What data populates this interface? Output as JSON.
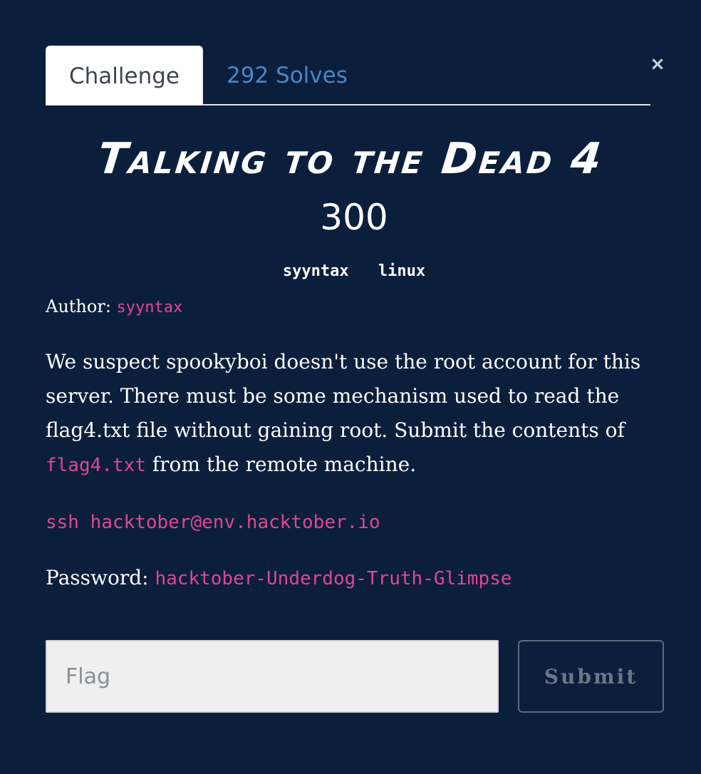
{
  "tabs": {
    "challenge": "Challenge",
    "solves": "292 Solves"
  },
  "close_icon": "×",
  "challenge": {
    "title": "Talking to the Dead 4",
    "points": "300",
    "tags": [
      "syyntax",
      "linux"
    ],
    "author_label": "Author:",
    "author_name": "syyntax",
    "description_part1": "We suspect spookyboi doesn't use the root account for this server. There must be some mechanism used to read the flag4.txt file without gaining root. Submit the contents of ",
    "description_code": "flag4.txt",
    "description_part2": " from the remote machine.",
    "ssh_command": "ssh hacktober@env.hacktober.io",
    "password_label": "Password:",
    "password_value": "hacktober-Underdog-Truth-Glimpse"
  },
  "form": {
    "flag_placeholder": "Flag",
    "flag_value": "",
    "submit_label": "Submit"
  },
  "colors": {
    "background": "#0b1f3d",
    "accent_pink": "#e3468f",
    "tab_link_blue": "#4a86c5"
  },
  "icons": {
    "close": "close-icon"
  }
}
